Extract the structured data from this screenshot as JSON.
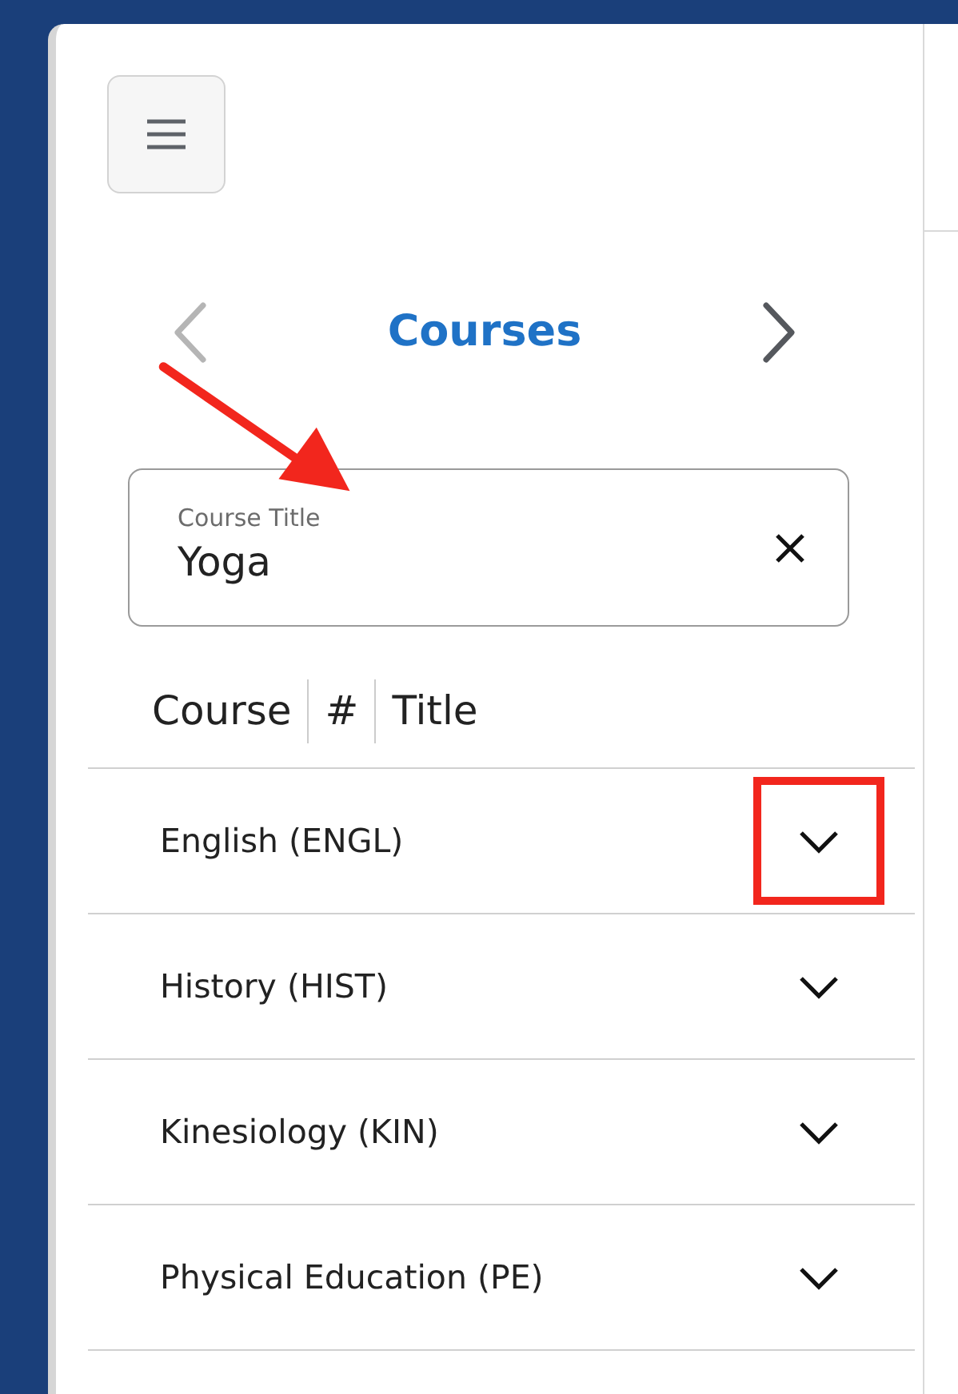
{
  "header": {
    "title": "Courses",
    "prev_disabled": true,
    "next_disabled": false
  },
  "search": {
    "label": "Course Title",
    "value": "Yoga",
    "annotated": true
  },
  "columns": [
    "Course",
    "#",
    "Title"
  ],
  "subjects": [
    {
      "name": "English (ENGL)",
      "expanded": false,
      "highlighted": true
    },
    {
      "name": "History (HIST)",
      "expanded": false,
      "highlighted": false
    },
    {
      "name": "Kinesiology (KIN)",
      "expanded": false,
      "highlighted": false
    },
    {
      "name": "Physical Education (PE)",
      "expanded": false,
      "highlighted": false
    }
  ]
}
